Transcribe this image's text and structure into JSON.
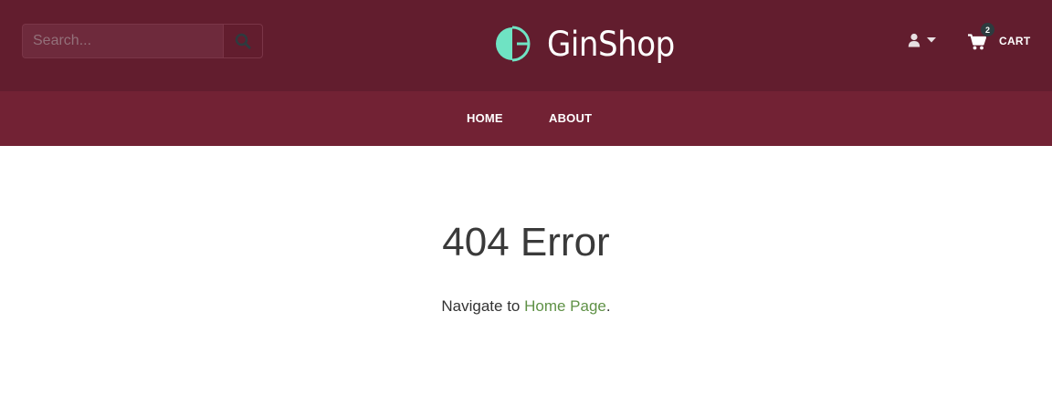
{
  "header": {
    "search": {
      "placeholder": "Search...",
      "value": "",
      "icon": "search-icon"
    },
    "brand": {
      "name": "GinShop",
      "logo_color": "#6fe3c3"
    },
    "user_menu": {
      "icon": "user-icon",
      "caret_icon": "caret-down-icon"
    },
    "cart": {
      "label": "CART",
      "count": "2",
      "icon": "cart-icon"
    }
  },
  "nav": {
    "items": [
      {
        "label": "HOME"
      },
      {
        "label": "ABOUT"
      }
    ]
  },
  "main": {
    "title": "404 Error",
    "message_prefix": "Navigate to ",
    "link_text": "Home Page",
    "message_suffix": "."
  },
  "colors": {
    "header_bg": "#621d2e",
    "nav_bg": "#722234",
    "link": "#5f9146",
    "brand_accent": "#6fe3c3"
  }
}
